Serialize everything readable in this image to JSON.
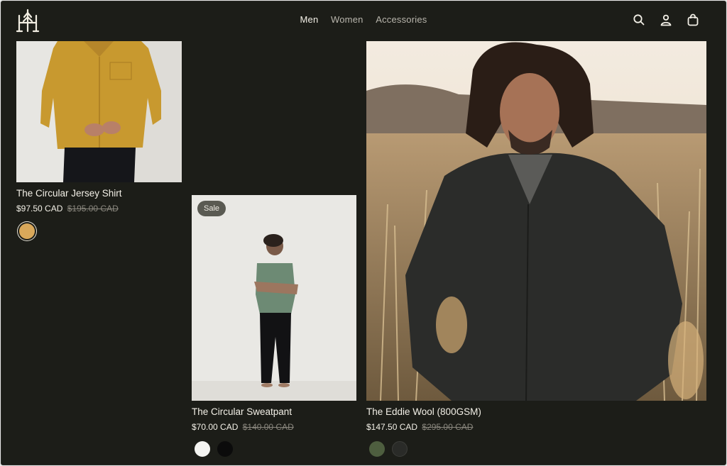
{
  "header": {
    "nav": [
      {
        "label": "Men",
        "active": true
      },
      {
        "label": "Women",
        "active": false
      },
      {
        "label": "Accessories",
        "active": false
      }
    ],
    "icons": [
      "search-icon",
      "account-icon",
      "cart-icon"
    ]
  },
  "products": [
    {
      "name": "The Circular Jersey Shirt",
      "price": "$97.50 CAD",
      "compare_price": "$195.00 CAD",
      "badge": "",
      "swatches": [
        "#d9a85a"
      ]
    },
    {
      "name": "The Circular Sweatpant",
      "price": "$70.00 CAD",
      "compare_price": "$140.00 CAD",
      "badge": "Sale",
      "swatches": [
        "#f4f4f1",
        "#0b0b0b"
      ]
    },
    {
      "name": "The Eddie Wool (800GSM)",
      "price": "$147.50 CAD",
      "compare_price": "$295.00 CAD",
      "badge": "",
      "swatches": [
        "#4e5e3f",
        "#2a2b28"
      ]
    }
  ],
  "colors": {
    "background": "#1c1d18",
    "text": "#f3f0e7",
    "muted": "#8a877e",
    "badge": "#5a5a52"
  }
}
